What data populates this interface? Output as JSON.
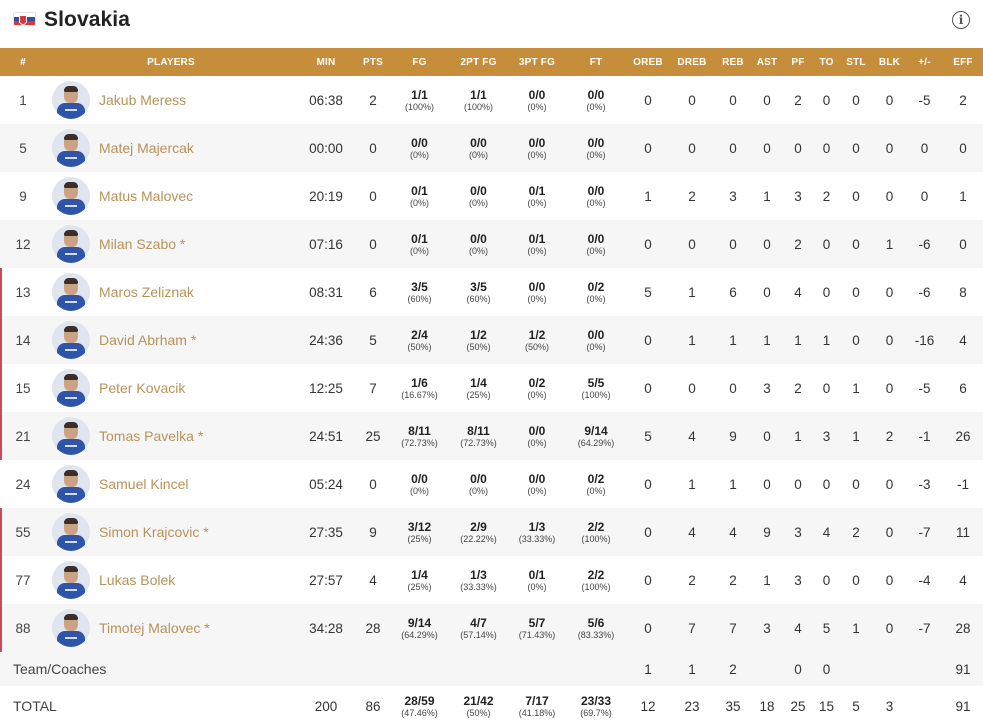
{
  "team": {
    "name": "Slovakia"
  },
  "columns": [
    "#",
    "PLAYERS",
    "MIN",
    "PTS",
    "FG",
    "2PT FG",
    "3PT FG",
    "FT",
    "OREB",
    "DREB",
    "REB",
    "AST",
    "PF",
    "TO",
    "STL",
    "BLK",
    "+/-",
    "EFF"
  ],
  "players": [
    {
      "num": "1",
      "name": "Jakub Meress",
      "min": "06:38",
      "pts": "2",
      "fg": "1/1",
      "fg_pct": "(100%)",
      "p2": "1/1",
      "p2_pct": "(100%)",
      "p3": "0/0",
      "p3_pct": "(0%)",
      "ft": "0/0",
      "ft_pct": "(0%)",
      "oreb": "0",
      "dreb": "0",
      "reb": "0",
      "ast": "0",
      "pf": "2",
      "to": "0",
      "stl": "0",
      "blk": "0",
      "pm": "-5",
      "eff": "2"
    },
    {
      "num": "5",
      "name": "Matej Majercak",
      "min": "00:00",
      "pts": "0",
      "fg": "0/0",
      "fg_pct": "(0%)",
      "p2": "0/0",
      "p2_pct": "(0%)",
      "p3": "0/0",
      "p3_pct": "(0%)",
      "ft": "0/0",
      "ft_pct": "(0%)",
      "oreb": "0",
      "dreb": "0",
      "reb": "0",
      "ast": "0",
      "pf": "0",
      "to": "0",
      "stl": "0",
      "blk": "0",
      "pm": "0",
      "eff": "0"
    },
    {
      "num": "9",
      "name": "Matus Malovec",
      "min": "20:19",
      "pts": "0",
      "fg": "0/1",
      "fg_pct": "(0%)",
      "p2": "0/0",
      "p2_pct": "(0%)",
      "p3": "0/1",
      "p3_pct": "(0%)",
      "ft": "0/0",
      "ft_pct": "(0%)",
      "oreb": "1",
      "dreb": "2",
      "reb": "3",
      "ast": "1",
      "pf": "3",
      "to": "2",
      "stl": "0",
      "blk": "0",
      "pm": "0",
      "eff": "1"
    },
    {
      "num": "12",
      "name": "Milan Szabo *",
      "min": "07:16",
      "pts": "0",
      "fg": "0/1",
      "fg_pct": "(0%)",
      "p2": "0/0",
      "p2_pct": "(0%)",
      "p3": "0/1",
      "p3_pct": "(0%)",
      "ft": "0/0",
      "ft_pct": "(0%)",
      "oreb": "0",
      "dreb": "0",
      "reb": "0",
      "ast": "0",
      "pf": "2",
      "to": "0",
      "stl": "0",
      "blk": "1",
      "pm": "-6",
      "eff": "0"
    },
    {
      "num": "13",
      "name": "Maros Zeliznak",
      "min": "08:31",
      "pts": "6",
      "fg": "3/5",
      "fg_pct": "(60%)",
      "p2": "3/5",
      "p2_pct": "(60%)",
      "p3": "0/0",
      "p3_pct": "(0%)",
      "ft": "0/2",
      "ft_pct": "(0%)",
      "oreb": "5",
      "dreb": "1",
      "reb": "6",
      "ast": "0",
      "pf": "4",
      "to": "0",
      "stl": "0",
      "blk": "0",
      "pm": "-6",
      "eff": "8"
    },
    {
      "num": "14",
      "name": "David Abrham *",
      "min": "24:36",
      "pts": "5",
      "fg": "2/4",
      "fg_pct": "(50%)",
      "p2": "1/2",
      "p2_pct": "(50%)",
      "p3": "1/2",
      "p3_pct": "(50%)",
      "ft": "0/0",
      "ft_pct": "(0%)",
      "oreb": "0",
      "dreb": "1",
      "reb": "1",
      "ast": "1",
      "pf": "1",
      "to": "1",
      "stl": "0",
      "blk": "0",
      "pm": "-16",
      "eff": "4"
    },
    {
      "num": "15",
      "name": "Peter Kovacik",
      "min": "12:25",
      "pts": "7",
      "fg": "1/6",
      "fg_pct": "(16.67%)",
      "p2": "1/4",
      "p2_pct": "(25%)",
      "p3": "0/2",
      "p3_pct": "(0%)",
      "ft": "5/5",
      "ft_pct": "(100%)",
      "oreb": "0",
      "dreb": "0",
      "reb": "0",
      "ast": "3",
      "pf": "2",
      "to": "0",
      "stl": "1",
      "blk": "0",
      "pm": "-5",
      "eff": "6"
    },
    {
      "num": "21",
      "name": "Tomas Pavelka *",
      "min": "24:51",
      "pts": "25",
      "fg": "8/11",
      "fg_pct": "(72.73%)",
      "p2": "8/11",
      "p2_pct": "(72.73%)",
      "p3": "0/0",
      "p3_pct": "(0%)",
      "ft": "9/14",
      "ft_pct": "(64.29%)",
      "oreb": "5",
      "dreb": "4",
      "reb": "9",
      "ast": "0",
      "pf": "1",
      "to": "3",
      "stl": "1",
      "blk": "2",
      "pm": "-1",
      "eff": "26"
    },
    {
      "num": "24",
      "name": "Samuel Kincel",
      "min": "05:24",
      "pts": "0",
      "fg": "0/0",
      "fg_pct": "(0%)",
      "p2": "0/0",
      "p2_pct": "(0%)",
      "p3": "0/0",
      "p3_pct": "(0%)",
      "ft": "0/2",
      "ft_pct": "(0%)",
      "oreb": "0",
      "dreb": "1",
      "reb": "1",
      "ast": "0",
      "pf": "0",
      "to": "0",
      "stl": "0",
      "blk": "0",
      "pm": "-3",
      "eff": "-1"
    },
    {
      "num": "55",
      "name": "Simon Krajcovic *",
      "min": "27:35",
      "pts": "9",
      "fg": "3/12",
      "fg_pct": "(25%)",
      "p2": "2/9",
      "p2_pct": "(22.22%)",
      "p3": "1/3",
      "p3_pct": "(33.33%)",
      "ft": "2/2",
      "ft_pct": "(100%)",
      "oreb": "0",
      "dreb": "4",
      "reb": "4",
      "ast": "9",
      "pf": "3",
      "to": "4",
      "stl": "2",
      "blk": "0",
      "pm": "-7",
      "eff": "11"
    },
    {
      "num": "77",
      "name": "Lukas Bolek",
      "min": "27:57",
      "pts": "4",
      "fg": "1/4",
      "fg_pct": "(25%)",
      "p2": "1/3",
      "p2_pct": "(33.33%)",
      "p3": "0/1",
      "p3_pct": "(0%)",
      "ft": "2/2",
      "ft_pct": "(100%)",
      "oreb": "0",
      "dreb": "2",
      "reb": "2",
      "ast": "1",
      "pf": "3",
      "to": "0",
      "stl": "0",
      "blk": "0",
      "pm": "-4",
      "eff": "4"
    },
    {
      "num": "88",
      "name": "Timotej Malovec *",
      "min": "34:28",
      "pts": "28",
      "fg": "9/14",
      "fg_pct": "(64.29%)",
      "p2": "4/7",
      "p2_pct": "(57.14%)",
      "p3": "5/7",
      "p3_pct": "(71.43%)",
      "ft": "5/6",
      "ft_pct": "(83.33%)",
      "oreb": "0",
      "dreb": "7",
      "reb": "7",
      "ast": "3",
      "pf": "4",
      "to": "5",
      "stl": "1",
      "blk": "0",
      "pm": "-7",
      "eff": "28"
    }
  ],
  "team_row": {
    "label": "Team/Coaches",
    "oreb": "1",
    "dreb": "1",
    "reb": "2",
    "ast": "",
    "pf": "0",
    "to": "0",
    "stl": "",
    "blk": "",
    "pm": "",
    "eff": "91"
  },
  "total_row": {
    "label": "TOTAL",
    "min": "200",
    "pts": "86",
    "fg": "28/59",
    "fg_pct": "(47.46%)",
    "p2": "21/42",
    "p2_pct": "(50%)",
    "p3": "7/17",
    "p3_pct": "(41.18%)",
    "ft": "23/33",
    "ft_pct": "(69.7%)",
    "oreb": "12",
    "dreb": "23",
    "reb": "35",
    "ast": "18",
    "pf": "25",
    "to": "15",
    "stl": "5",
    "blk": "3",
    "pm": "",
    "eff": "91"
  },
  "colors": {
    "header_bg": "#c68e3b",
    "player_name": "#b8925a",
    "accent_mark": "#c94a5a"
  }
}
